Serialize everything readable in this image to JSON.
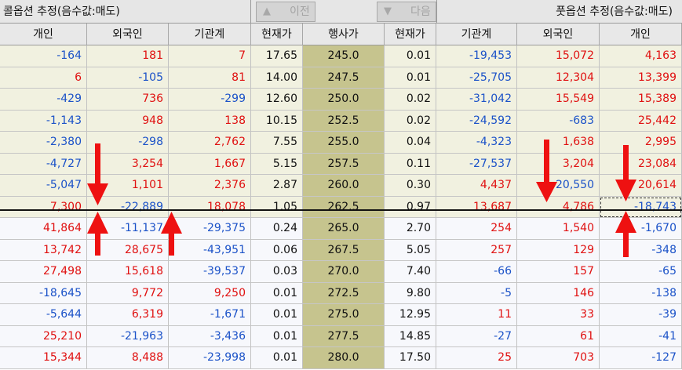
{
  "toolbar": {
    "call_title": "콜옵션 추정(음수값:매도)",
    "put_title": "풋옵션 추정(음수값:매도)",
    "prev_label": "이전",
    "next_label": "다음",
    "prev_icon": "triangle-up-icon",
    "next_icon": "triangle-down-icon"
  },
  "columns": [
    "개인",
    "외국인",
    "기관계",
    "현재가",
    "행사가",
    "현재가",
    "기관계",
    "외국인",
    "개인"
  ],
  "colors": {
    "positive": "#e01010",
    "negative": "#1b52c8",
    "itm_row": "#f1f1e0",
    "otm_row": "#f7f8fc",
    "strike_column": "#c6c48e",
    "arrow": "#ee1111"
  },
  "atm_row_index": 7,
  "selected_cell": {
    "row": 7,
    "column": 8
  },
  "rows": [
    {
      "call": {
        "indiv": "-164",
        "foreign": "181",
        "inst": "7",
        "price": "17.65"
      },
      "strike": "245.0",
      "put": {
        "price": "0.01",
        "inst": "-19,453",
        "foreign": "15,072",
        "indiv": "4,163"
      }
    },
    {
      "call": {
        "indiv": "6",
        "foreign": "-105",
        "inst": "81",
        "price": "14.00"
      },
      "strike": "247.5",
      "put": {
        "price": "0.01",
        "inst": "-25,705",
        "foreign": "12,304",
        "indiv": "13,399"
      }
    },
    {
      "call": {
        "indiv": "-429",
        "foreign": "736",
        "inst": "-299",
        "price": "12.60"
      },
      "strike": "250.0",
      "put": {
        "price": "0.02",
        "inst": "-31,042",
        "foreign": "15,549",
        "indiv": "15,389"
      }
    },
    {
      "call": {
        "indiv": "-1,143",
        "foreign": "948",
        "inst": "138",
        "price": "10.15"
      },
      "strike": "252.5",
      "put": {
        "price": "0.02",
        "inst": "-24,592",
        "foreign": "-683",
        "indiv": "25,442"
      }
    },
    {
      "call": {
        "indiv": "-2,380",
        "foreign": "-298",
        "inst": "2,762",
        "price": "7.55"
      },
      "strike": "255.0",
      "put": {
        "price": "0.04",
        "inst": "-4,323",
        "foreign": "1,638",
        "indiv": "2,995"
      }
    },
    {
      "call": {
        "indiv": "-4,727",
        "foreign": "3,254",
        "inst": "1,667",
        "price": "5.15"
      },
      "strike": "257.5",
      "put": {
        "price": "0.11",
        "inst": "-27,537",
        "foreign": "3,204",
        "indiv": "23,084"
      }
    },
    {
      "call": {
        "indiv": "-5,047",
        "foreign": "1,101",
        "inst": "2,376",
        "price": "2.87"
      },
      "strike": "260.0",
      "put": {
        "price": "0.30",
        "inst": "4,437",
        "foreign": "-20,550",
        "indiv": "20,614"
      }
    },
    {
      "call": {
        "indiv": "7,300",
        "foreign": "-22,889",
        "inst": "18,078",
        "price": "1.05"
      },
      "strike": "262.5",
      "put": {
        "price": "0.97",
        "inst": "13,687",
        "foreign": "4,786",
        "indiv": "-18,743"
      }
    },
    {
      "call": {
        "indiv": "41,864",
        "foreign": "-11,137",
        "inst": "-29,375",
        "price": "0.24"
      },
      "strike": "265.0",
      "put": {
        "price": "2.70",
        "inst": "254",
        "foreign": "1,540",
        "indiv": "-1,670"
      }
    },
    {
      "call": {
        "indiv": "13,742",
        "foreign": "28,675",
        "inst": "-43,951",
        "price": "0.06"
      },
      "strike": "267.5",
      "put": {
        "price": "5.05",
        "inst": "257",
        "foreign": "129",
        "indiv": "-348"
      }
    },
    {
      "call": {
        "indiv": "27,498",
        "foreign": "15,618",
        "inst": "-39,537",
        "price": "0.03"
      },
      "strike": "270.0",
      "put": {
        "price": "7.40",
        "inst": "-66",
        "foreign": "157",
        "indiv": "-65"
      }
    },
    {
      "call": {
        "indiv": "-18,645",
        "foreign": "9,772",
        "inst": "9,250",
        "price": "0.01"
      },
      "strike": "272.5",
      "put": {
        "price": "9.80",
        "inst": "-5",
        "foreign": "146",
        "indiv": "-138"
      }
    },
    {
      "call": {
        "indiv": "-5,644",
        "foreign": "6,319",
        "inst": "-1,671",
        "price": "0.01"
      },
      "strike": "275.0",
      "put": {
        "price": "12.95",
        "inst": "11",
        "foreign": "33",
        "indiv": "-39"
      }
    },
    {
      "call": {
        "indiv": "25,210",
        "foreign": "-21,963",
        "inst": "-3,436",
        "price": "0.01"
      },
      "strike": "277.5",
      "put": {
        "price": "14.85",
        "inst": "-27",
        "foreign": "61",
        "indiv": "-41"
      }
    },
    {
      "call": {
        "indiv": "15,344",
        "foreign": "8,488",
        "inst": "-23,998",
        "price": "0.01"
      },
      "strike": "280.0",
      "put": {
        "price": "17.50",
        "inst": "25",
        "foreign": "703",
        "indiv": "-127"
      }
    }
  ],
  "annotations": [
    {
      "name": "call-indiv-down-arrow",
      "direction": "down"
    },
    {
      "name": "call-indiv-up-arrow",
      "direction": "up"
    },
    {
      "name": "call-inst-up-arrow",
      "direction": "up"
    },
    {
      "name": "put-foreign-down-arrow",
      "direction": "down"
    },
    {
      "name": "put-indiv-down-arrow",
      "direction": "down"
    },
    {
      "name": "put-indiv-up-arrow",
      "direction": "up"
    }
  ]
}
